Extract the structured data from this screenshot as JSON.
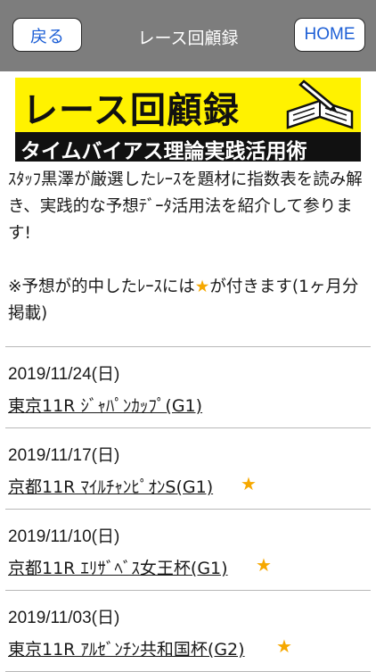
{
  "nav": {
    "back_label": "戻る",
    "title": "レース回顧録",
    "home_label": "HOME"
  },
  "banner": {
    "title": "レース回顧録",
    "subtitle": "タイムバイアス理論実践活用術"
  },
  "intro": {
    "paragraph": "ｽﾀｯﾌ黒澤が厳選したﾚｰｽを題材に指数表を読み解き、実践的な予想ﾃﾞｰﾀ活用法を紹介して参ります!",
    "note_prefix": "※予想が的中したﾚｰｽには",
    "note_star": "★",
    "note_suffix": "が付きます(1ヶ月分掲載)"
  },
  "races": [
    {
      "date": "2019/11/24(日)",
      "name": "東京11R ｼﾞｬﾊﾟﾝｶｯﾌﾟ(G1)",
      "star": ""
    },
    {
      "date": "2019/11/17(日)",
      "name": "京都11R ﾏｲﾙﾁｬﾝﾋﾟｵﾝS(G1)",
      "star": "★"
    },
    {
      "date": "2019/11/10(日)",
      "name": "京都11R ｴﾘｻﾞﾍﾞｽ女王杯(G1)",
      "star": "★"
    },
    {
      "date": "2019/11/03(日)",
      "name": "東京11R ｱﾙｾﾞﾝﾁﾝ共和国杯(G2)",
      "star": "★"
    }
  ],
  "colors": {
    "nav_bar": "#7d7d7d",
    "link_blue": "#1d5fd6",
    "banner_yellow": "#fff200",
    "star": "#f6a800"
  }
}
